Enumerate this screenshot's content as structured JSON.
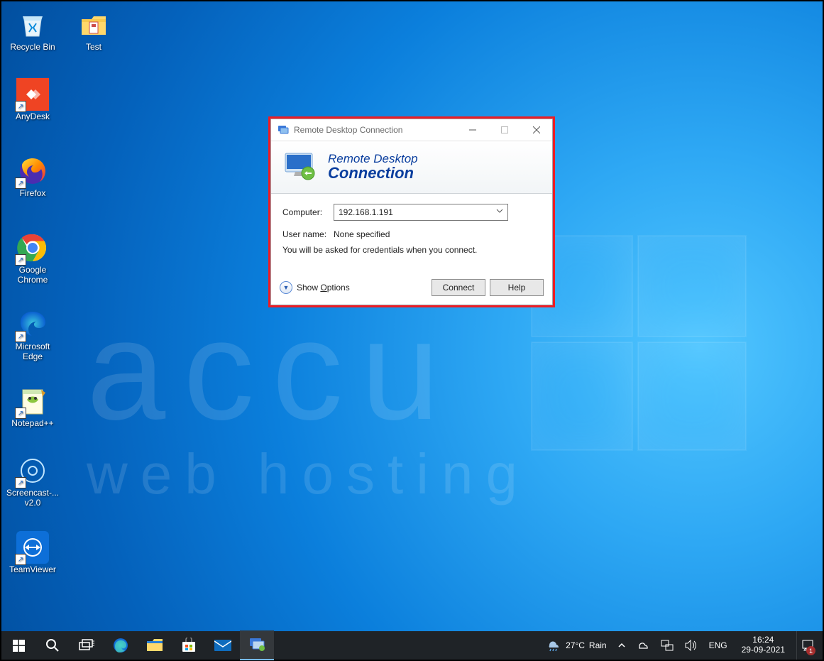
{
  "desktop_icons": [
    {
      "id": "recycle-bin",
      "label": "Recycle Bin",
      "shortcut": false
    },
    {
      "id": "test-folder",
      "label": "Test",
      "shortcut": false
    },
    {
      "id": "anydesk",
      "label": "AnyDesk",
      "shortcut": true
    },
    {
      "id": "firefox",
      "label": "Firefox",
      "shortcut": true
    },
    {
      "id": "chrome",
      "label": "Google Chrome",
      "shortcut": true
    },
    {
      "id": "edge",
      "label": "Microsoft Edge",
      "shortcut": true
    },
    {
      "id": "notepadpp",
      "label": "Notepad++",
      "shortcut": true
    },
    {
      "id": "screencast",
      "label": "Screencast-... v2.0",
      "shortcut": true
    },
    {
      "id": "teamviewer",
      "label": "TeamViewer",
      "shortcut": true
    }
  ],
  "rdc": {
    "title": "Remote Desktop Connection",
    "banner_line1": "Remote Desktop",
    "banner_line2": "Connection",
    "computer_label": "Computer:",
    "computer_value": "192.168.1.191",
    "username_label": "User name:",
    "username_value": "None specified",
    "note": "You will be asked for credentials when you connect.",
    "show_options": "Show Options",
    "connect": "Connect",
    "help": "Help"
  },
  "taskbar": {
    "weather_temp": "27°C",
    "weather_cond": "Rain",
    "lang": "ENG",
    "time": "16:24",
    "date": "29-09-2021",
    "notif_count": "1"
  },
  "watermark_top": "accu",
  "watermark_bottom": "web  hosting"
}
